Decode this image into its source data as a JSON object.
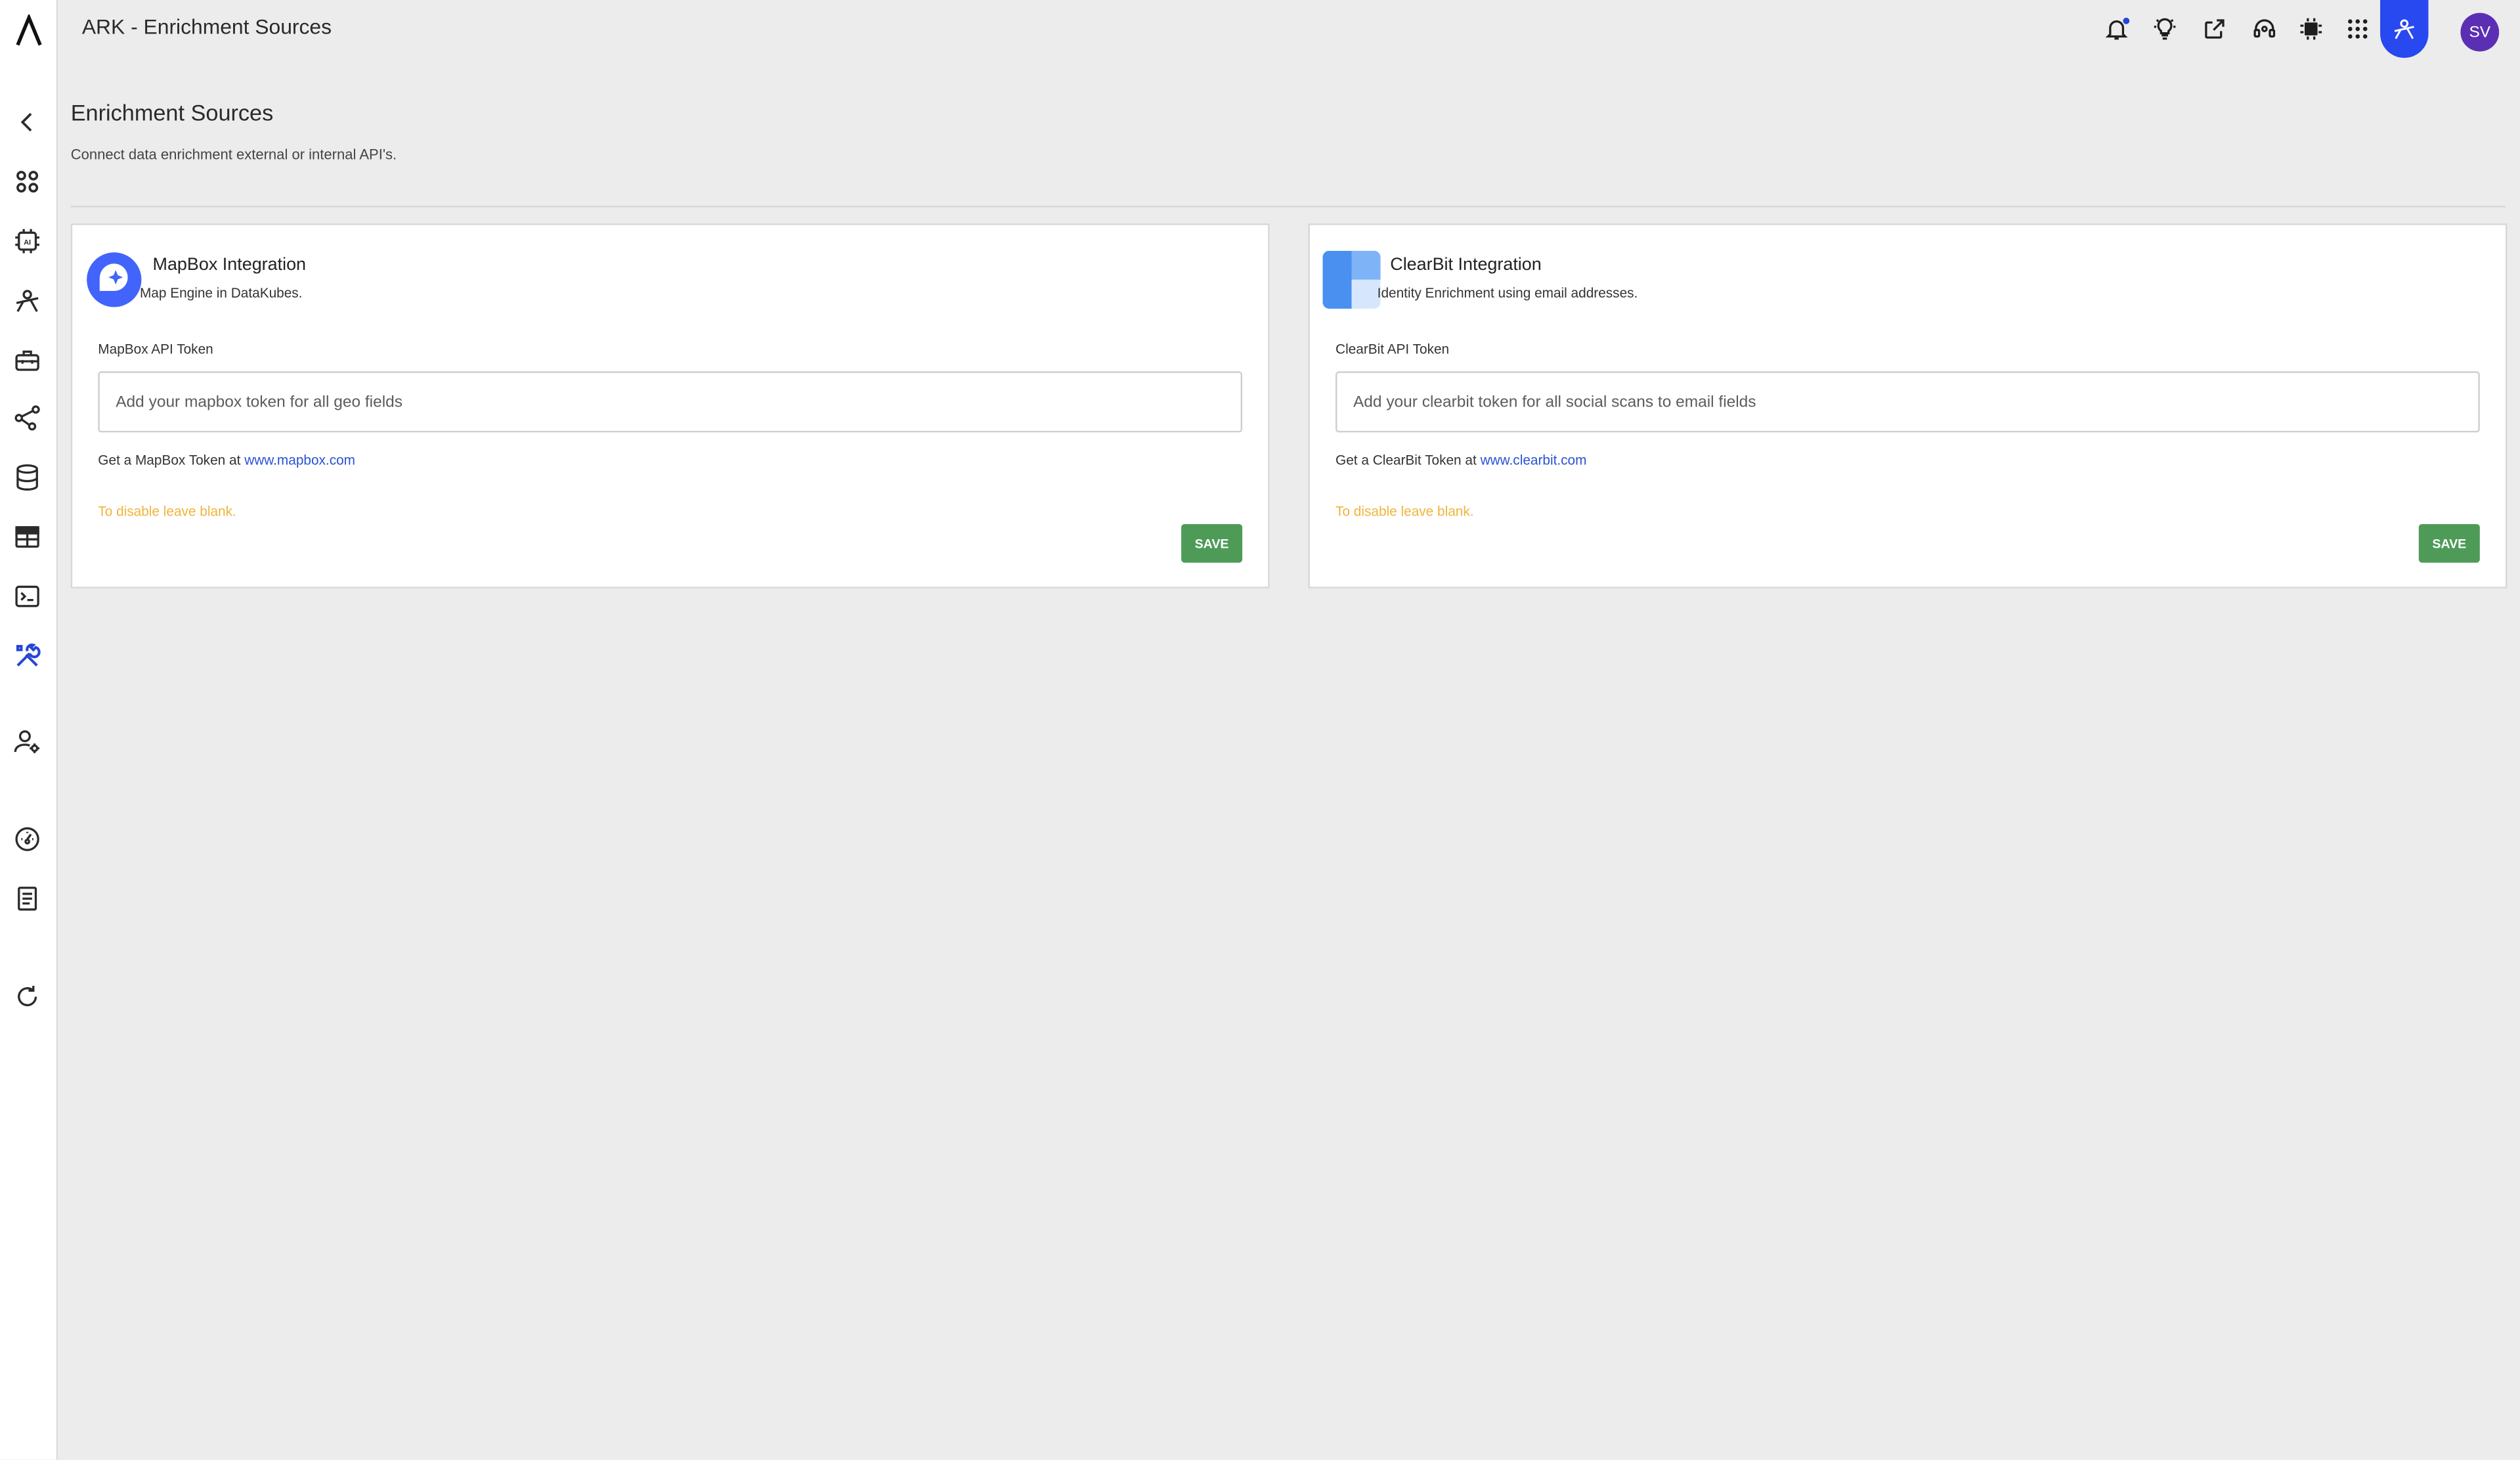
{
  "app": {
    "title": "ARK - Enrichment Sources"
  },
  "sidebar": {
    "items": [
      {
        "name": "back-icon"
      },
      {
        "name": "dashboard-grid-icon"
      },
      {
        "name": "ai-chip-icon"
      },
      {
        "name": "user-network-icon"
      },
      {
        "name": "toolbox-icon"
      },
      {
        "name": "connections-icon"
      },
      {
        "name": "database-icon"
      },
      {
        "name": "table-icon"
      },
      {
        "name": "terminal-icon"
      },
      {
        "name": "tools-icon",
        "active": true
      },
      {
        "name": "user-settings-icon"
      },
      {
        "name": "speedometer-icon"
      },
      {
        "name": "book-icon"
      },
      {
        "name": "refresh-icon"
      }
    ]
  },
  "topbar": {
    "icons": [
      "bell-icon",
      "lightbulb-icon",
      "share-icon",
      "support-headset-icon",
      "chip-icon",
      "apps-grid-icon",
      "user-network-icon"
    ],
    "avatar_initials": "SV"
  },
  "page": {
    "title": "Enrichment Sources",
    "subtitle": "Connect data enrichment external or internal API's."
  },
  "integrations": [
    {
      "title": "MapBox Integration",
      "description": "Map Engine in DataKubes.",
      "field_label": "MapBox API Token",
      "placeholder": "Add your mapbox token for all geo fields",
      "value": "",
      "help_prefix": "Get a MapBox Token at",
      "help_link": "www.mapbox.com",
      "warning": "To disable leave blank.",
      "save_label": "SAVE",
      "logo": "mapbox-logo-icon"
    },
    {
      "title": "ClearBit Integration",
      "description": "Identity Enrichment using email addresses.",
      "field_label": "ClearBit API Token",
      "placeholder": "Add your clearbit token for all social scans to email fields",
      "value": "",
      "help_prefix": "Get a ClearBit Token at",
      "help_link": "www.clearbit.com",
      "warning": "To disable leave blank.",
      "save_label": "SAVE",
      "logo": "clearbit-logo-icon"
    }
  ],
  "colors": {
    "accent": "#2848f0",
    "save_button": "#4e9b58",
    "warning_text": "#f0b43c",
    "link": "#2a52d6",
    "avatar": "#5a2fb3"
  }
}
